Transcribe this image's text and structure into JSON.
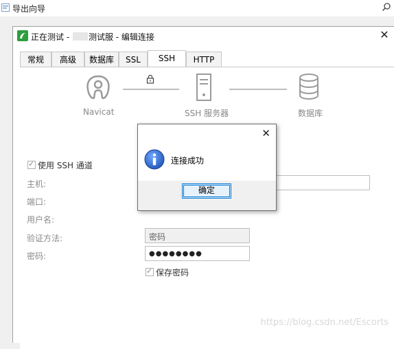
{
  "outer": {
    "title": "导出向导"
  },
  "dialog": {
    "title_prefix": "正在测试 - ",
    "title_suffix": "测试服 - 编辑连接",
    "close": "✕"
  },
  "tabs": [
    {
      "label": "常规",
      "active": false
    },
    {
      "label": "高级",
      "active": false
    },
    {
      "label": "数据库",
      "active": false
    },
    {
      "label": "SSL",
      "active": false
    },
    {
      "label": "SSH",
      "active": true
    },
    {
      "label": "HTTP",
      "active": false
    }
  ],
  "diagram": {
    "left_label": "Navicat",
    "middle_label": "SSH 服务器",
    "right_label": "数据库"
  },
  "form": {
    "use_ssh": "使用 SSH 通道",
    "host_label": "主机:",
    "port_label": "端口:",
    "user_label": "用户名:",
    "auth_label": "验证方法:",
    "auth_value": "密码",
    "password_label": "密码:",
    "password_value": "●●●●●●●●",
    "save_password": "保存密码"
  },
  "message_box": {
    "text": "连接成功",
    "ok_label": "确定",
    "close": "✕"
  },
  "watermark": "https://blog.csdn.net/Escorts",
  "colors": {
    "accent": "#0078d7",
    "info_icon": "#1f57b8",
    "navicat_green": "#2e9e3e"
  }
}
